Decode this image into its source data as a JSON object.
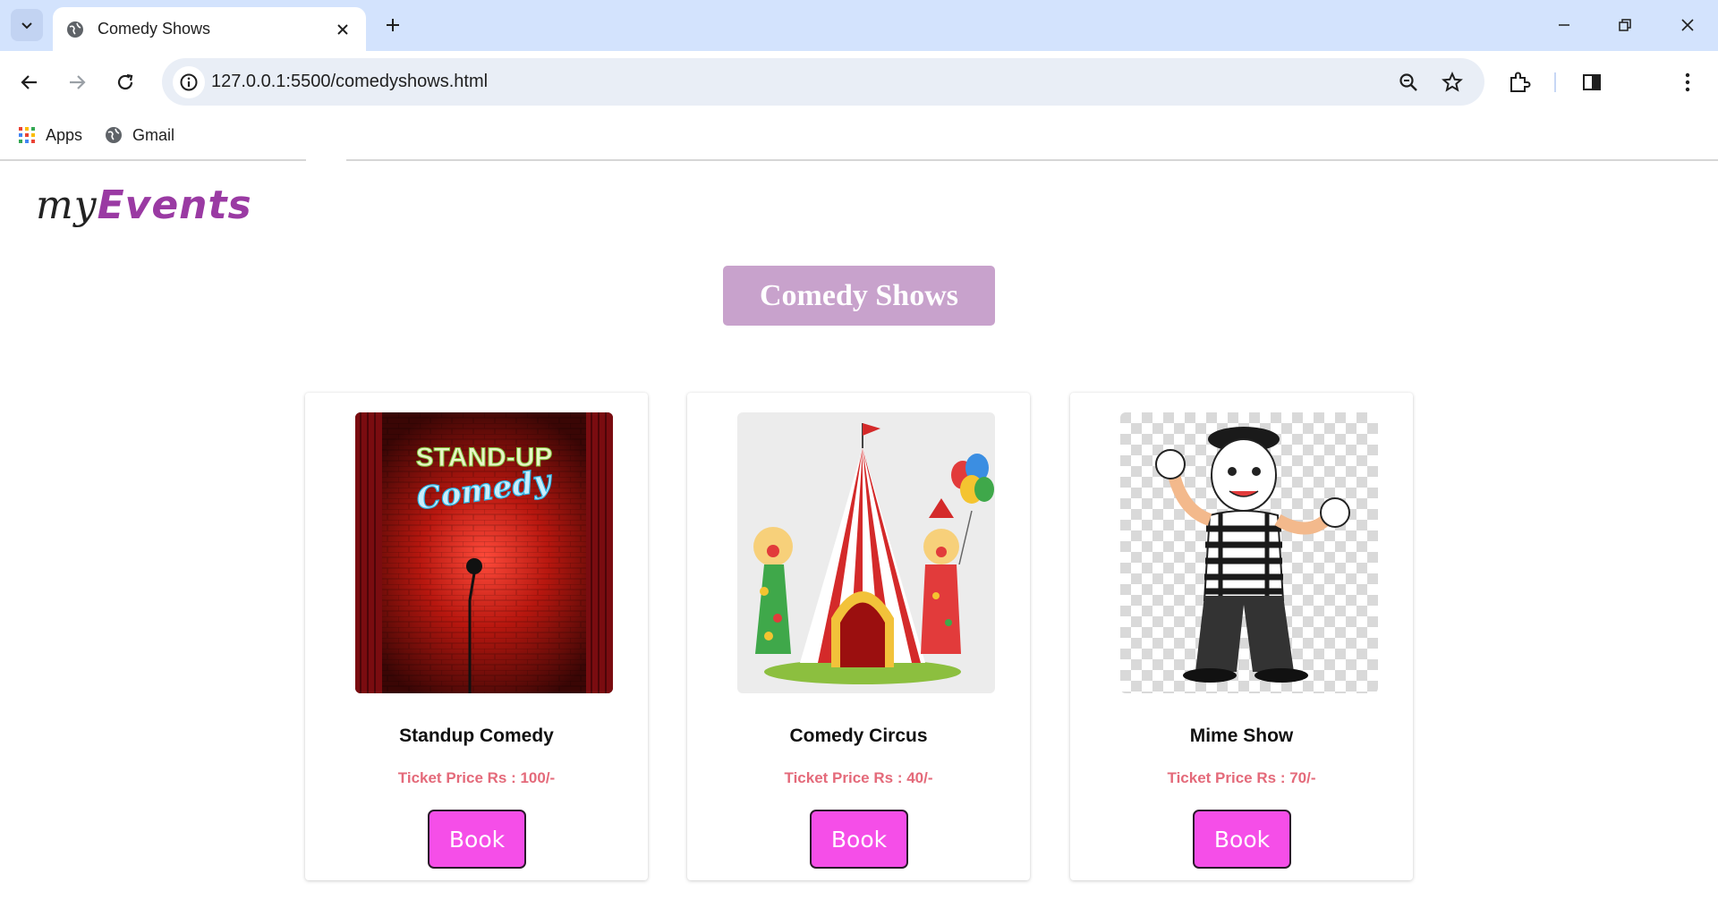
{
  "browser": {
    "tab_title": "Comedy Shows",
    "url": "127.0.0.1:5500/comedyshows.html",
    "bookmarks": [
      {
        "label": "Apps",
        "icon": "apps-grid-icon"
      },
      {
        "label": "Gmail",
        "icon": "globe-icon"
      }
    ]
  },
  "site": {
    "logo_my": "my",
    "logo_events": "Events",
    "heading": "Comedy Shows"
  },
  "colors": {
    "heading_bg": "#c8a2cc",
    "price_text": "#e46a7a",
    "book_button": "#f54ee8",
    "logo_accent": "#9a3aa3"
  },
  "shows": [
    {
      "title": "Standup Comedy",
      "price": "Ticket Price Rs : 100/-",
      "button": "Book",
      "image": "standup-comedy-stage-image"
    },
    {
      "title": "Comedy Circus",
      "price": "Ticket Price Rs : 40/-",
      "button": "Book",
      "image": "circus-clowns-image"
    },
    {
      "title": "Mime Show",
      "price": "Ticket Price Rs : 70/-",
      "button": "Book",
      "image": "mime-performer-image"
    }
  ]
}
